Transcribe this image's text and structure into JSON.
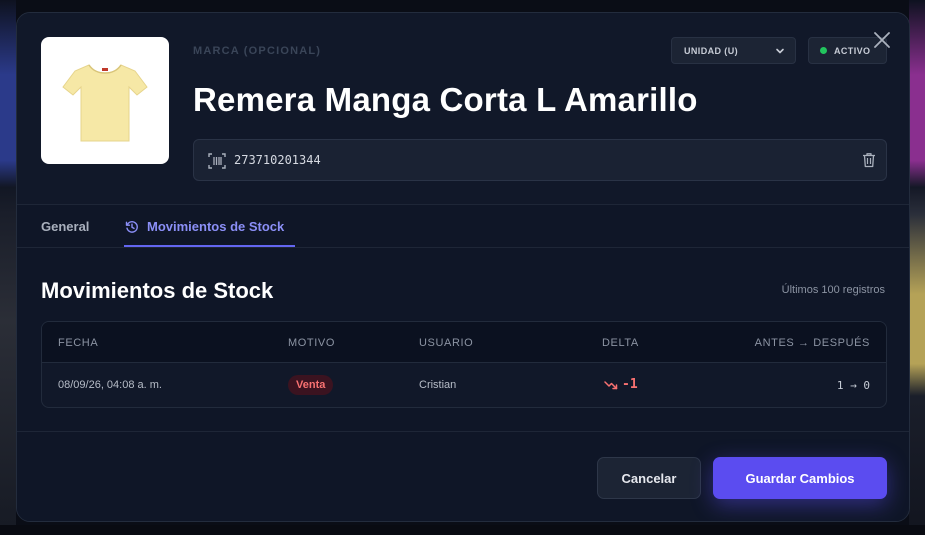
{
  "header": {
    "brand_placeholder": "MARCA (OPCIONAL)",
    "product_name": "Remera Manga Corta L Amarillo",
    "unit_select": {
      "selected": "UNIDAD (U)"
    },
    "status": {
      "label": "ACTIVO",
      "color": "#22c55e"
    },
    "barcode": "273710201344",
    "product_image_color": "#f6e8a6"
  },
  "tabs": [
    {
      "label": "General",
      "active": false
    },
    {
      "label": "Movimientos de Stock",
      "active": true
    }
  ],
  "section": {
    "title": "Movimientos de Stock",
    "note": "Últimos 100 registros"
  },
  "table": {
    "columns": [
      "FECHA",
      "MOTIVO",
      "USUARIO",
      "DELTA",
      "ANTES → DESPUÉS"
    ],
    "rows": [
      {
        "fecha": "08/09/26, 04:08 a. m.",
        "motivo": "Venta",
        "usuario": "Cristian",
        "delta": "-1",
        "antes_despues": "1 → 0"
      }
    ]
  },
  "footer": {
    "cancel_label": "Cancelar",
    "save_label": "Guardar Cambios"
  },
  "colors": {
    "accent": "#6366f1",
    "save_button": "#5b4cf0",
    "negative": "#f87171"
  }
}
